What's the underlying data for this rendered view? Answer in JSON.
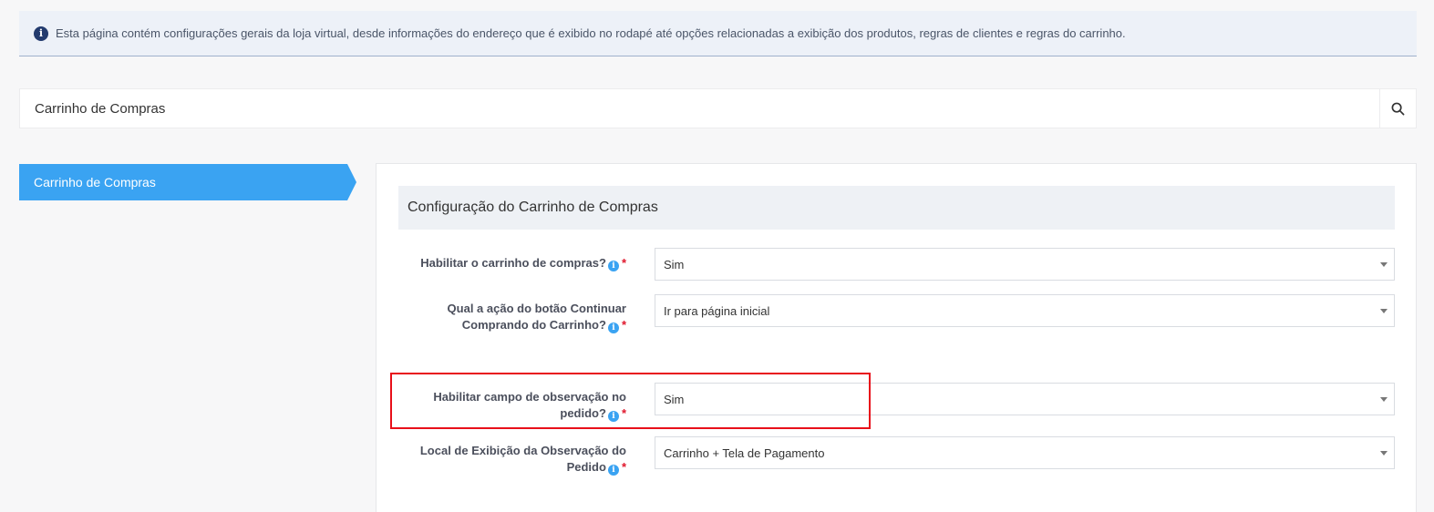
{
  "banner": {
    "icon": "info-icon",
    "text": "Esta página contém configurações gerais da loja virtual, desde informações do endereço que é exibido no rodapé até opções relacionadas a exibição dos produtos, regras de clientes e regras do carrinho."
  },
  "search": {
    "value": "Carrinho de Compras",
    "icon": "search-icon"
  },
  "sidebar": {
    "active_tab": "Carrinho de Compras",
    "accent_color": "#3aa3f2"
  },
  "panel": {
    "title": "Configuração do Carrinho de Compras",
    "fields": [
      {
        "label_lines": [
          "Habilitar o carrinho de compras?"
        ],
        "value": "Sim"
      },
      {
        "label_lines": [
          "Qual a ação do botão Continuar",
          "Comprando do Carrinho?"
        ],
        "value": "Ir para página inicial"
      },
      {
        "label_lines": [
          "Habilitar campo de observação no",
          "pedido?"
        ],
        "value": "Sim"
      },
      {
        "label_lines": [
          "Local de Exibição da Observação do",
          "Pedido"
        ],
        "value": "Carrinho + Tela de Pagamento"
      }
    ],
    "required_marker": "*",
    "info_marker": "i"
  },
  "annotation": {
    "highlight_color": "#e8101a"
  }
}
